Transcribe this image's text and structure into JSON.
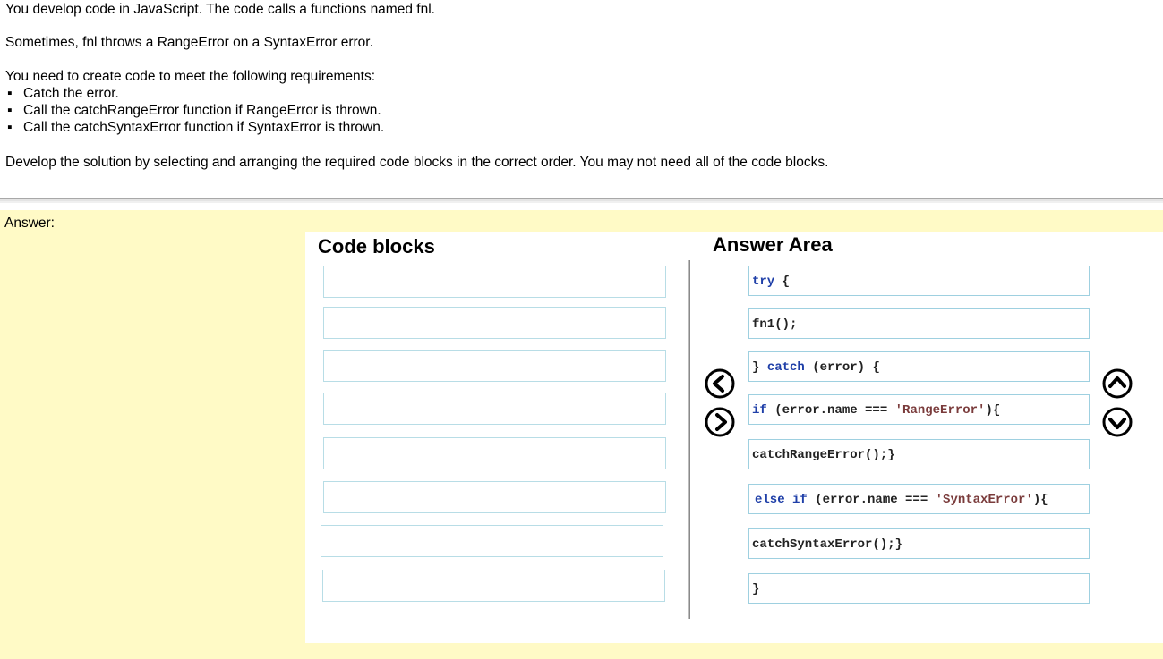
{
  "question": {
    "line1": "You develop code in JavaScript. The code calls a functions named fnl.",
    "line2": "Sometimes, fnl throws a RangeError on a SyntaxError error.",
    "line3": "You need to create code to meet the following requirements:",
    "requirements": [
      "Catch the error.",
      "Call the catchRangeError function if RangeError is thrown.",
      "Call the catchSyntaxError function if SyntaxError is thrown."
    ],
    "line4": "Develop the solution by selecting and arranging the required code blocks in the correct order. You may not need all of the code blocks."
  },
  "answer_label": "Answer:",
  "code_blocks_heading": "Code blocks",
  "answer_area_heading": "Answer Area",
  "answer_blocks": [
    {
      "kw1": "try",
      "t1": " {",
      "kw2": "",
      "str": "",
      "t2": ""
    },
    {
      "kw1": "",
      "t1": "fn1();",
      "kw2": "",
      "str": "",
      "t2": ""
    },
    {
      "kw1": "",
      "t1": "} ",
      "kw2": "catch",
      "str": "",
      "t2": " (error) {"
    },
    {
      "kw1": "if",
      "t1": " (error.name === ",
      "kw2": "",
      "str": "'RangeError'",
      "t2": "){"
    },
    {
      "kw1": "",
      "t1": "catchRangeError();}",
      "kw2": "",
      "str": "",
      "t2": ""
    },
    {
      "kw1": "else if",
      "t1": " (error.name === ",
      "kw2": "",
      "str": "'SyntaxError'",
      "t2": "){"
    },
    {
      "kw1": "",
      "t1": "catchSyntaxError();}",
      "kw2": "",
      "str": "",
      "t2": ""
    },
    {
      "kw1": "",
      "t1": "}",
      "kw2": "",
      "str": "",
      "t2": ""
    }
  ],
  "icons": {
    "move_left": "chevron-left-circle-icon",
    "move_right": "chevron-right-circle-icon",
    "move_up": "chevron-up-circle-icon",
    "move_down": "chevron-down-circle-icon"
  },
  "colors": {
    "answer_background": "#fffac6",
    "keyword": "#1f3fa8",
    "string": "#7a3b3b",
    "slot_border": "#b8dde6"
  }
}
